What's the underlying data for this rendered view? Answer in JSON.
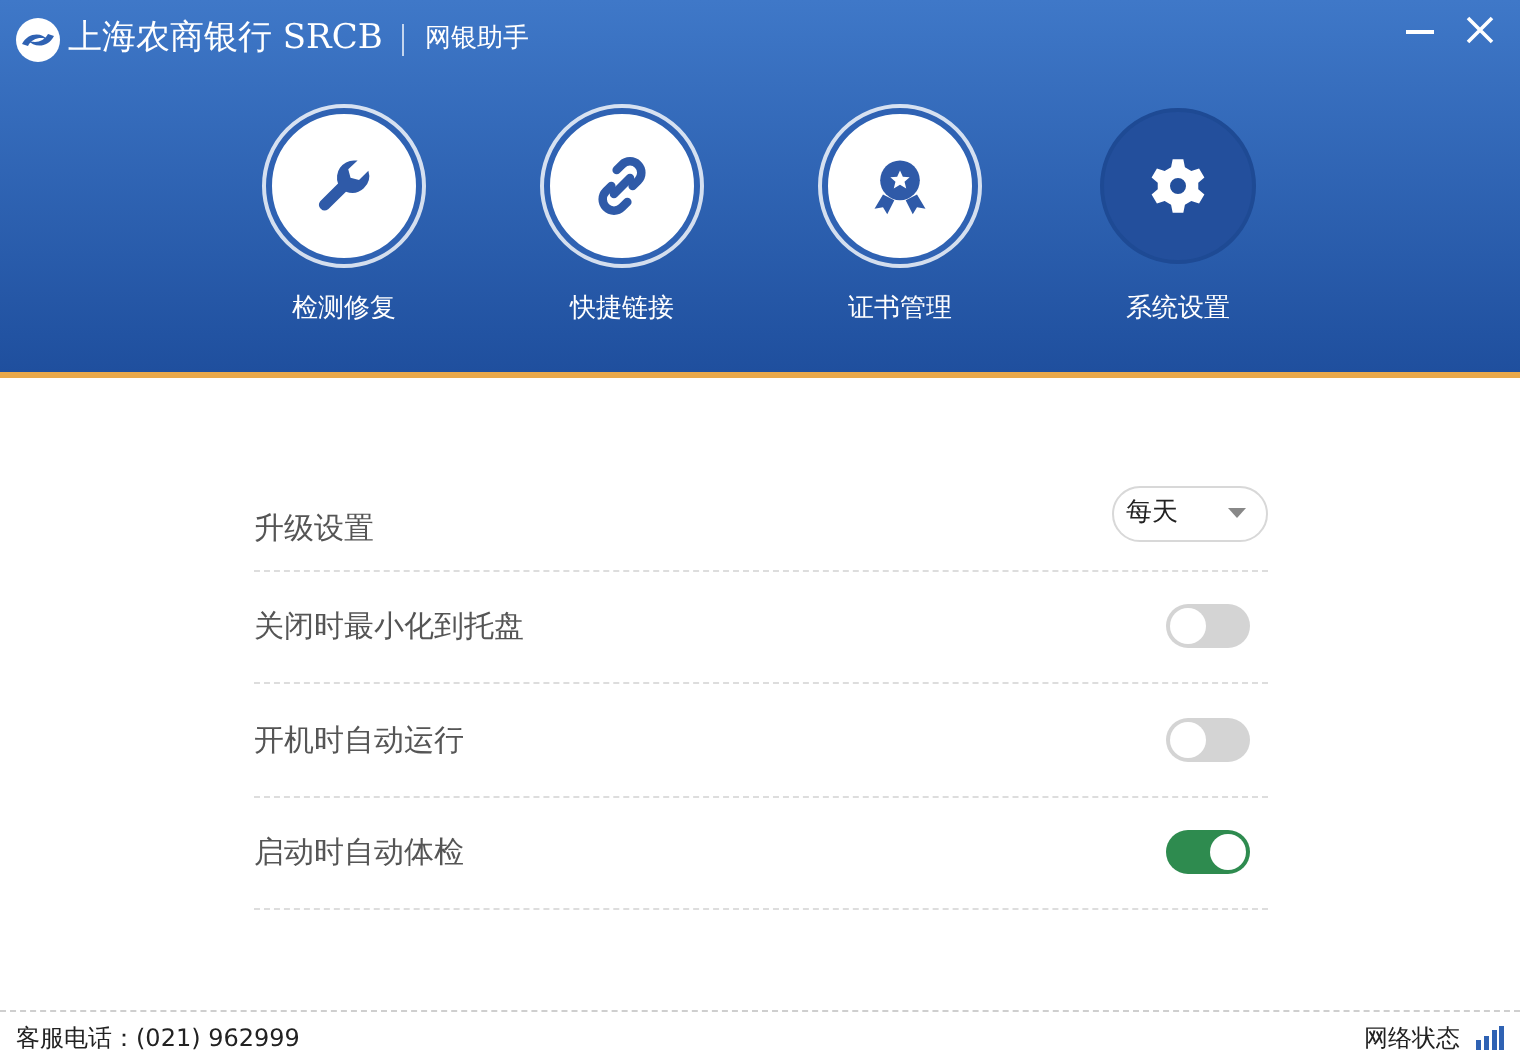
{
  "header": {
    "brand": "上海农商银行 SRCB",
    "subtitle": "网银助手"
  },
  "nav": [
    {
      "label": "检测修复",
      "selected": false
    },
    {
      "label": "快捷链接",
      "selected": false
    },
    {
      "label": "证书管理",
      "selected": false
    },
    {
      "label": "系统设置",
      "selected": true
    }
  ],
  "settings": [
    {
      "kind": "dropdown",
      "label": "升级设置",
      "value": "每天"
    },
    {
      "kind": "toggle",
      "label": "关闭时最小化到托盘",
      "on": false
    },
    {
      "kind": "toggle",
      "label": "开机时自动运行",
      "on": false
    },
    {
      "kind": "toggle",
      "label": "启动时自动体检",
      "on": true
    }
  ],
  "status_bar": {
    "hotline": "客服电话：(021) 962999",
    "network": "网络状态"
  }
}
